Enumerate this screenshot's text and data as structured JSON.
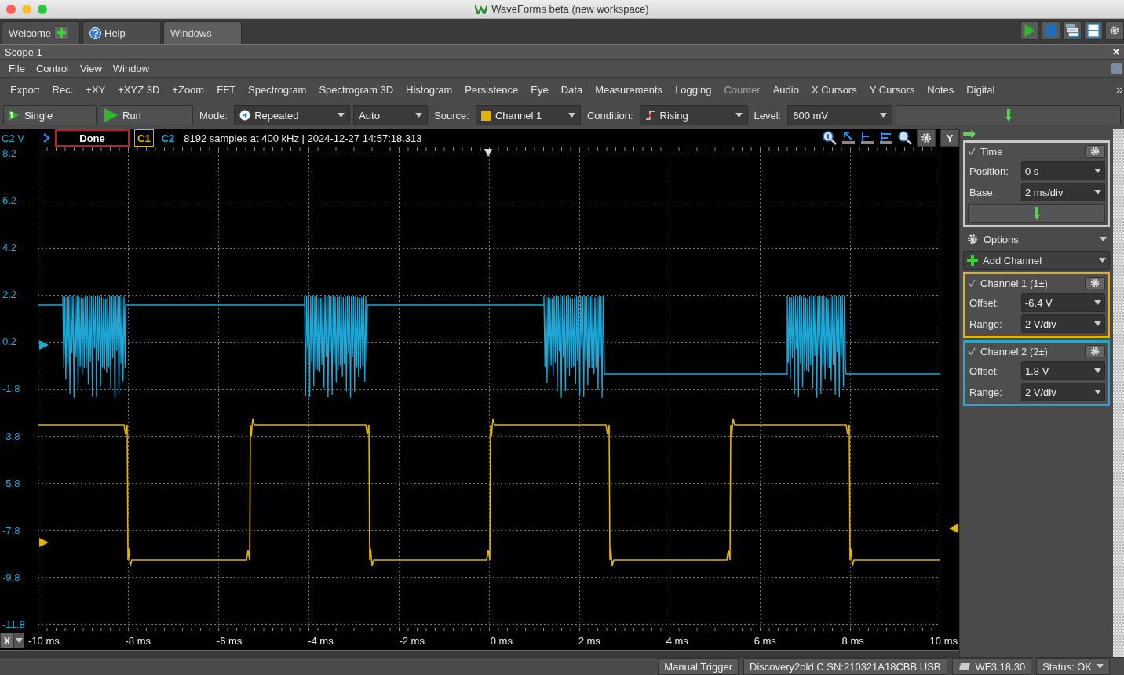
{
  "window": {
    "title": "WaveForms beta (new workspace)"
  },
  "tabs": [
    {
      "label": "Welcome",
      "kind": "welcome",
      "selected": false
    },
    {
      "label": "Help",
      "kind": "help",
      "selected": false
    },
    {
      "label": "Windows",
      "kind": "plain",
      "selected": true
    }
  ],
  "document_title": "Scope 1",
  "menu": [
    "File",
    "Control",
    "View",
    "Window"
  ],
  "toolbar": [
    {
      "label": "Export",
      "disabled": false
    },
    {
      "label": "Rec.",
      "disabled": false
    },
    {
      "label": "+XY",
      "disabled": false
    },
    {
      "label": "+XYZ 3D",
      "disabled": false
    },
    {
      "label": "+Zoom",
      "disabled": false
    },
    {
      "label": "FFT",
      "disabled": false
    },
    {
      "label": "Spectrogram",
      "disabled": false
    },
    {
      "label": "Spectrogram 3D",
      "disabled": false
    },
    {
      "label": "Histogram",
      "disabled": false
    },
    {
      "label": "Persistence",
      "disabled": false
    },
    {
      "label": "Eye",
      "disabled": false
    },
    {
      "label": "Data",
      "disabled": false
    },
    {
      "label": "Measurements",
      "disabled": false
    },
    {
      "label": "Logging",
      "disabled": false
    },
    {
      "label": "Counter",
      "disabled": true
    },
    {
      "label": "Audio",
      "disabled": false
    },
    {
      "label": "X Cursors",
      "disabled": false
    },
    {
      "label": "Y Cursors",
      "disabled": false
    },
    {
      "label": "Notes",
      "disabled": false
    },
    {
      "label": "Digital",
      "disabled": false
    }
  ],
  "acquisition": {
    "single": "Single",
    "run": "Run",
    "mode_label": "Mode:",
    "mode": "Repeated",
    "trigger_mode": "Auto",
    "source_label": "Source:",
    "source": "Channel 1",
    "condition_label": "Condition:",
    "condition": "Rising",
    "level_label": "Level:",
    "level": "600 mV"
  },
  "plot": {
    "axis_label": "C2 V",
    "state": "Done",
    "channel_tags": [
      {
        "label": "C1",
        "color": "#e0b400",
        "selected": true
      },
      {
        "label": "C2",
        "color": "#1ea8d8",
        "selected": false
      }
    ],
    "info": "8192 samples at 400 kHz | 2024-12-27 14:57:18.313",
    "y_button": "Y",
    "x_button": "X",
    "y_ticks": [
      "8.2",
      "6.2",
      "4.2",
      "2.2",
      "0.2",
      "-1.8",
      "-3.8",
      "-5.8",
      "-7.8",
      "-9.8",
      "-11.8"
    ],
    "x_ticks": [
      "-10 ms",
      "-8 ms",
      "-6 ms",
      "-4 ms",
      "-2 ms",
      "0 ms",
      "2 ms",
      "4 ms",
      "6 ms",
      "8 ms",
      "10 ms"
    ]
  },
  "side_panel": {
    "time": {
      "title": "Time",
      "checked": true,
      "fields": [
        {
          "label": "Position:",
          "value": "0 s"
        },
        {
          "label": "Base:",
          "value": "2 ms/div"
        }
      ]
    },
    "options": "Options",
    "add_channel": "Add Channel",
    "channels": [
      {
        "title": "Channel 1 (1±)",
        "color": "#e0b400",
        "checked": true,
        "fields": [
          {
            "label": "Offset:",
            "value": "-6.4 V"
          },
          {
            "label": "Range:",
            "value": "2 V/div"
          }
        ]
      },
      {
        "title": "Channel 2 (2±)",
        "color": "#1ea8d8",
        "checked": true,
        "fields": [
          {
            "label": "Offset:",
            "value": "1.8 V"
          },
          {
            "label": "Range:",
            "value": "2 V/div"
          }
        ]
      }
    ]
  },
  "status_bar": {
    "trigger": "Manual Trigger",
    "device": "Discovery2old C SN:210321A18CBB USB",
    "version": "WF3.18.30",
    "status": "Status: OK"
  }
}
